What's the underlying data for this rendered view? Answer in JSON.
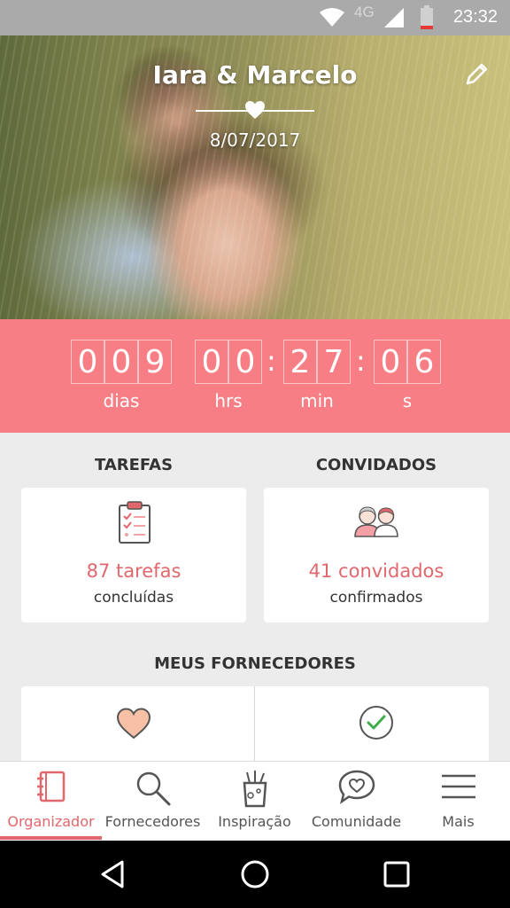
{
  "status_bar": {
    "time": "23:32",
    "network": "4G"
  },
  "hero": {
    "couple_name": "Iara & Marcelo",
    "date": "8/07/2017"
  },
  "countdown": {
    "days": [
      "0",
      "0",
      "9"
    ],
    "hours": [
      "0",
      "0"
    ],
    "minutes": [
      "2",
      "7"
    ],
    "seconds": [
      "0",
      "6"
    ],
    "labels": {
      "days": "dias",
      "hours": "hrs",
      "minutes": "min",
      "seconds": "s"
    }
  },
  "tasks": {
    "title": "TAREFAS",
    "count_text": "87 tarefas",
    "sub_text": "concluídas"
  },
  "guests": {
    "title": "CONVIDADOS",
    "count_text": "41 convidados",
    "sub_text": "confirmados"
  },
  "vendors": {
    "title": "MEUS FORNECEDORES"
  },
  "bottom_nav": {
    "items": [
      {
        "label": "Organizador",
        "icon": "notebook-icon",
        "active": true
      },
      {
        "label": "Fornecedores",
        "icon": "search-icon",
        "active": false
      },
      {
        "label": "Inspiração",
        "icon": "cup-icon",
        "active": false
      },
      {
        "label": "Comunidade",
        "icon": "chat-heart-icon",
        "active": false
      },
      {
        "label": "Mais",
        "icon": "menu-icon",
        "active": false
      }
    ]
  },
  "colors": {
    "accent": "#e2676d",
    "countdown_bg": "#f67e84",
    "heart_fill": "#f8c1a6",
    "check": "#3fae49"
  }
}
